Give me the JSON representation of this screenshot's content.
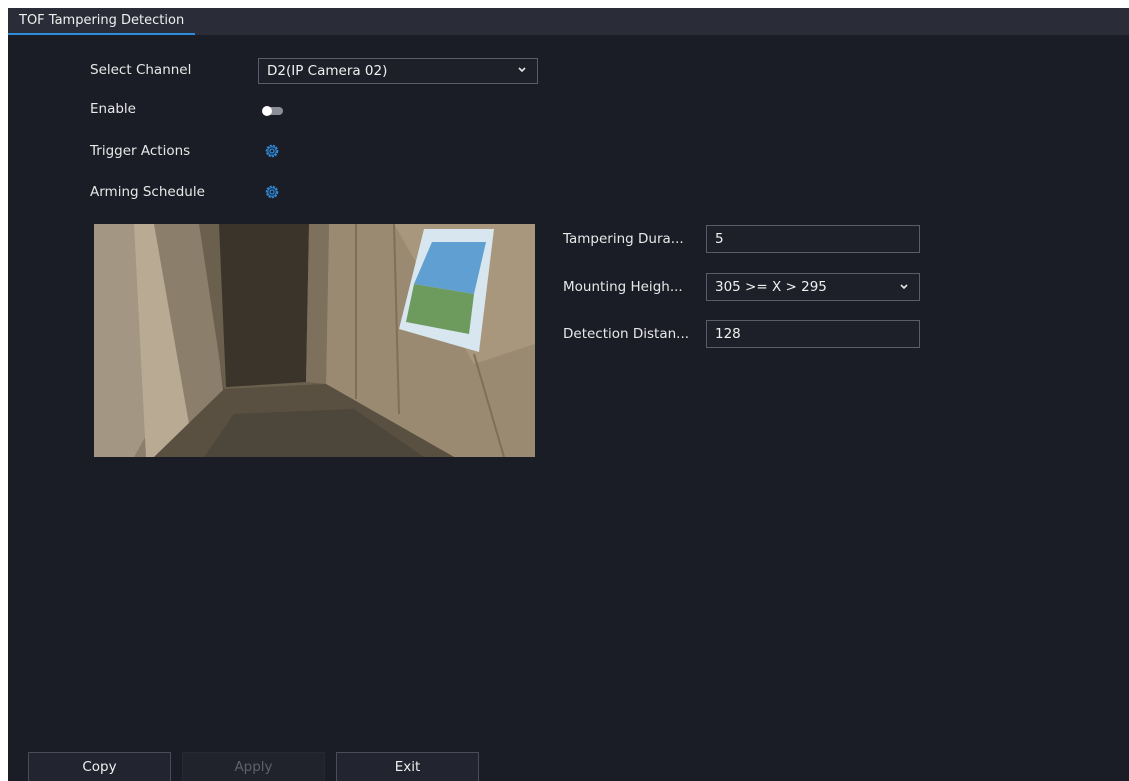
{
  "tab": {
    "title": "TOF Tampering Detection"
  },
  "settings": {
    "select_channel": {
      "label": "Select Channel",
      "value": "D2(IP Camera 02)"
    },
    "enable": {
      "label": "Enable",
      "on": false
    },
    "trigger_actions": {
      "label": "Trigger Actions",
      "icon": "gear-icon"
    },
    "arming_schedule": {
      "label": "Arming Schedule",
      "icon": "gear-icon"
    }
  },
  "params": {
    "tampering_duration": {
      "label": "Tampering Dura...",
      "value": "5"
    },
    "mounting_height": {
      "label": "Mounting Heigh...",
      "value": "305 >= X > 295"
    },
    "detection_distance": {
      "label": "Detection Distan...",
      "value": "128"
    }
  },
  "footer": {
    "copy": "Copy",
    "apply": "Apply",
    "exit": "Exit"
  },
  "colors": {
    "accent": "#2f8bdb",
    "background": "#1b1d26",
    "toggle_off": "#8b8d96"
  }
}
